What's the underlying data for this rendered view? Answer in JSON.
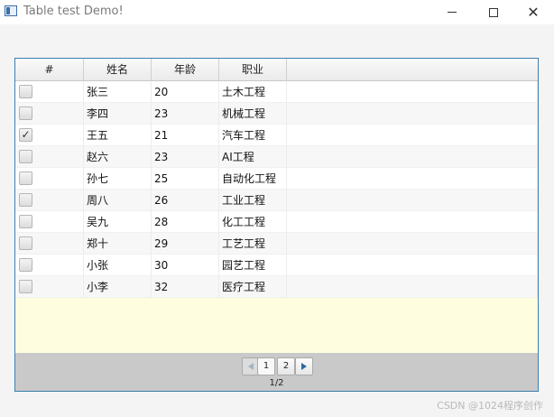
{
  "window": {
    "title": "Table test Demo!",
    "minimize_icon": "minimize-icon",
    "maximize_icon": "maximize-icon",
    "close_icon": "close-icon"
  },
  "table": {
    "columns": [
      "#",
      "姓名",
      "年龄",
      "职业"
    ],
    "rows": [
      {
        "checked": false,
        "name": "张三",
        "age": "20",
        "job": "土木工程"
      },
      {
        "checked": false,
        "name": "李四",
        "age": "23",
        "job": "机械工程"
      },
      {
        "checked": true,
        "name": "王五",
        "age": "21",
        "job": "汽车工程"
      },
      {
        "checked": false,
        "name": "赵六",
        "age": "23",
        "job": "AI工程"
      },
      {
        "checked": false,
        "name": "孙七",
        "age": "25",
        "job": "自动化工程"
      },
      {
        "checked": false,
        "name": "周八",
        "age": "26",
        "job": "工业工程"
      },
      {
        "checked": false,
        "name": "吴九",
        "age": "28",
        "job": "化工工程"
      },
      {
        "checked": false,
        "name": "郑十",
        "age": "29",
        "job": "工艺工程"
      },
      {
        "checked": false,
        "name": "小张",
        "age": "30",
        "job": "园艺工程"
      },
      {
        "checked": false,
        "name": "小李",
        "age": "32",
        "job": "医疗工程"
      }
    ],
    "selection_color": "#fffde0",
    "border_color": "#3c7fb1"
  },
  "pagination": {
    "pages": [
      "1",
      "2"
    ],
    "current_page": "1",
    "page_info": "1/2",
    "prev_icon": "arrow-left-icon",
    "next_icon": "arrow-right-icon"
  },
  "watermark": "CSDN @1024程序创作"
}
